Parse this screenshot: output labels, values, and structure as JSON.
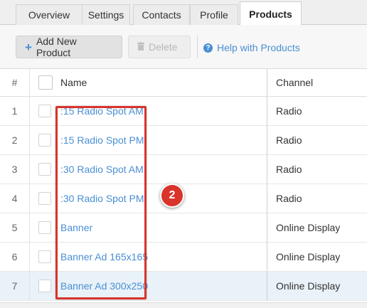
{
  "tabs": [
    {
      "label": "Overview",
      "active": false
    },
    {
      "label": "Settings",
      "active": false
    },
    {
      "label": "Contacts",
      "active": false
    },
    {
      "label": "Profile",
      "active": false
    },
    {
      "label": "Products",
      "active": true
    }
  ],
  "toolbar": {
    "add_label": "Add New Product",
    "delete_label": "Delete",
    "help_label": "Help with Products"
  },
  "table": {
    "headers": {
      "number": "#",
      "name": "Name",
      "channel": "Channel"
    },
    "rows": [
      {
        "number": "1",
        "name": ":15 Radio Spot AM",
        "channel": "Radio"
      },
      {
        "number": "2",
        "name": ":15 Radio Spot PM",
        "channel": "Radio"
      },
      {
        "number": "3",
        "name": ":30 Radio Spot AM",
        "channel": "Radio"
      },
      {
        "number": "4",
        "name": ":30 Radio Spot PM",
        "channel": "Radio"
      },
      {
        "number": "5",
        "name": "Banner",
        "channel": "Online Display"
      },
      {
        "number": "6",
        "name": "Banner Ad 165x165",
        "channel": "Online Display"
      },
      {
        "number": "7",
        "name": "Banner Ad 300x250",
        "channel": "Online Display"
      }
    ]
  },
  "annotation": {
    "step_number": "2"
  },
  "colors": {
    "accent": "#4a8fd4",
    "annotation": "#d9342b",
    "selected_row": "#e9f2f8"
  }
}
